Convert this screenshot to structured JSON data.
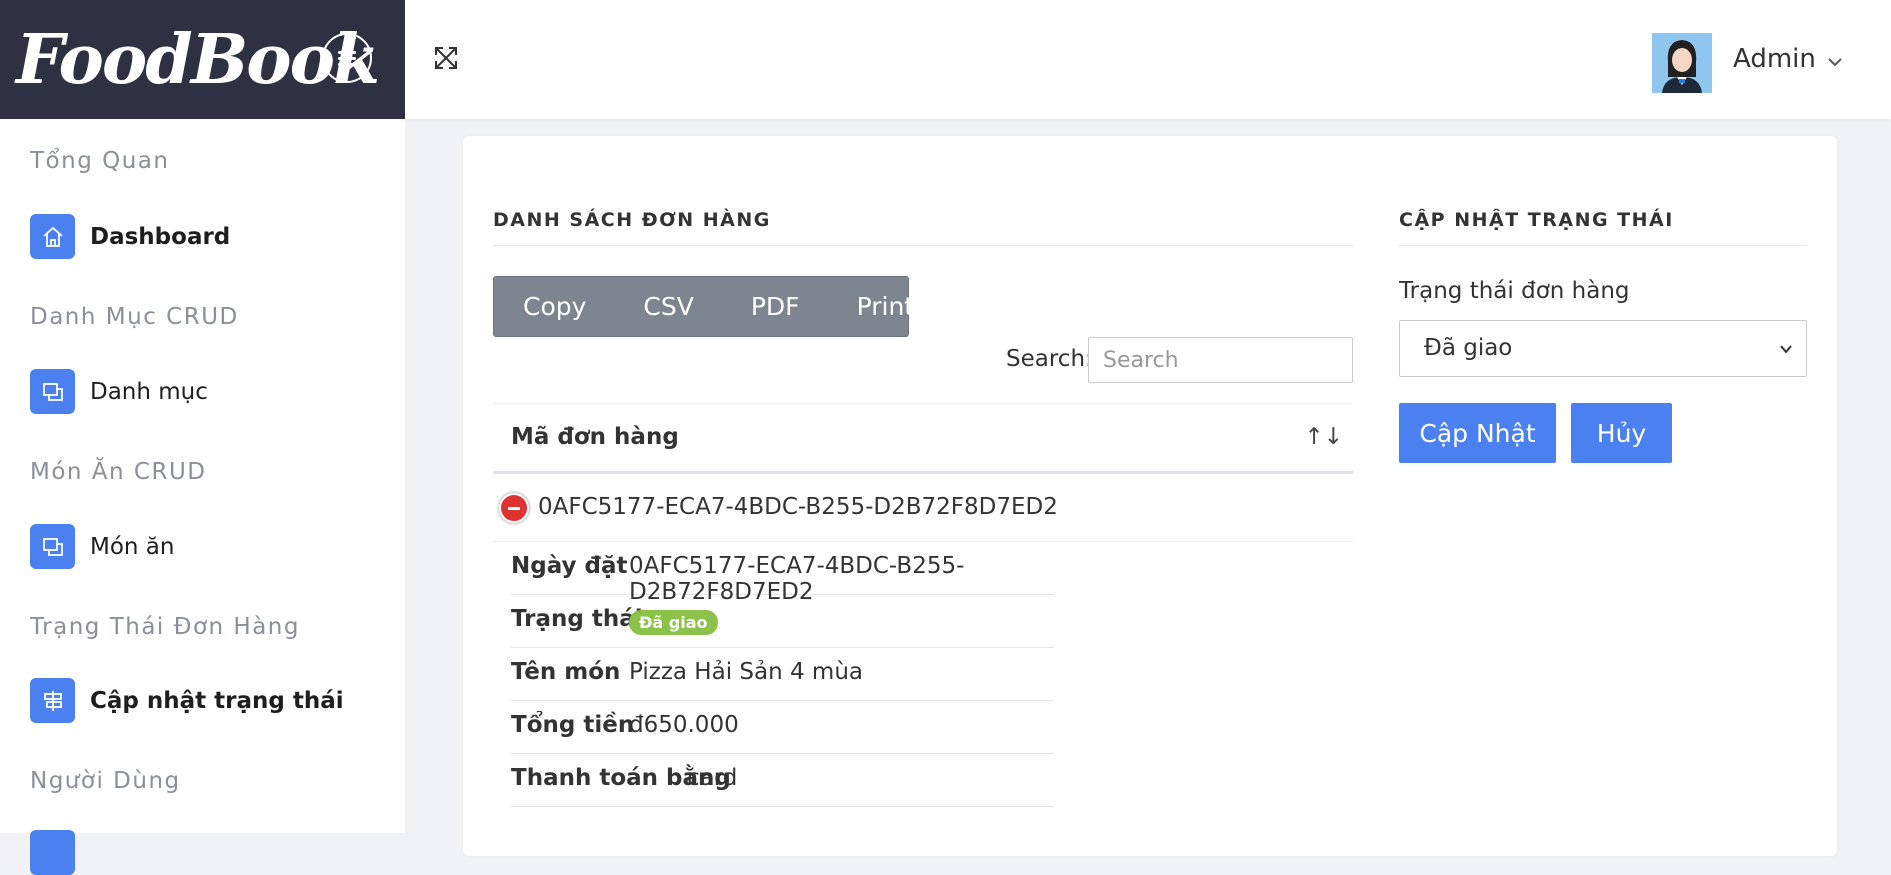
{
  "brand": {
    "logo_text": "FoodBook"
  },
  "sidebar": {
    "sections": [
      {
        "title": "Tổng Quan",
        "item": "Dashboard"
      },
      {
        "title": "Danh Mục CRUD",
        "item": "Danh mục"
      },
      {
        "title": "Món Ăn CRUD",
        "item": "Món ăn"
      },
      {
        "title": "Trạng Thái Đơn Hàng",
        "item": "Cập nhật trạng thái"
      },
      {
        "title": "Người Dùng",
        "item": ""
      }
    ]
  },
  "topbar": {
    "user_name": "Admin"
  },
  "orders": {
    "title": "DANH SÁCH ĐƠN HÀNG",
    "buttons": {
      "copy": "Copy",
      "csv": "CSV",
      "pdf": "PDF",
      "print": "Print"
    },
    "search_label": "Search:",
    "search_placeholder": "Search",
    "column_header": "Mã đơn hàng",
    "sort_glyph": "↑↓",
    "row_id": "0AFC5177-ECA7-4BDC-B255-D2B72F8D7ED2",
    "details": {
      "date_label": "Ngày đặt",
      "date_value": "0AFC5177-ECA7-4BDC-B255-D2B72F8D7ED2",
      "status_label": "Trạng thái",
      "status_value": "Đã giao",
      "dish_label": "Tên món",
      "dish_value": "Pizza Hải Sản 4 mùa",
      "total_label": "Tổng tiền",
      "total_value": "đ650.000",
      "payment_label": "Thanh toán bằng",
      "payment_value": "card"
    }
  },
  "update_status": {
    "title": "CẬP NHẬT TRẠNG THÁI",
    "field_label": "Trạng thái đơn hàng",
    "selected": "Đã giao",
    "update_button": "Cập Nhật",
    "cancel_button": "Hủy"
  },
  "colors": {
    "accent": "#4a80f0",
    "sidebar_dark": "#2d3142",
    "badge_green": "#8bc34a"
  }
}
